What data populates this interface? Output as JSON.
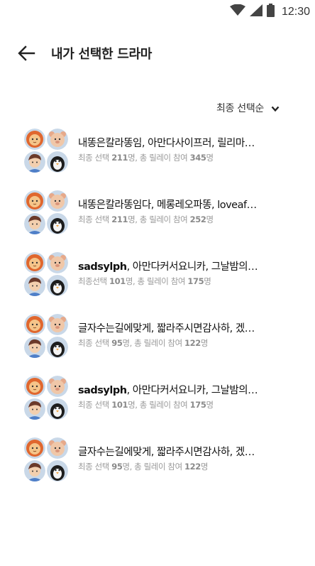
{
  "status_bar": {
    "time": "12:30"
  },
  "header": {
    "title": "내가 선택한 드라마"
  },
  "sort": {
    "label": "최종 선택순"
  },
  "meta_labels": {
    "selected": "최종 선택",
    "selected_compact": "최종선택",
    "people": "명",
    "total": ", 총 릴레이 참여"
  },
  "dramas": [
    {
      "title_bold": "",
      "title_rest": "내똥은칼라똥임, 아만다사이프러, 릴리마…",
      "selected": "211",
      "total": "345",
      "compact": false
    },
    {
      "title_bold": "",
      "title_rest": "내똥은칼라똥임다, 메롱레오파똥, loveaf…",
      "selected": "211",
      "total": "252",
      "compact": false
    },
    {
      "title_bold": "sadsylph",
      "title_rest": ", 아만다커서요니카, 그날밤의…",
      "selected": "101",
      "total": "175",
      "compact": true
    },
    {
      "title_bold": "",
      "title_rest": "글자수는길에맞게, 짧라주시면감사하, 겠…",
      "selected": "95",
      "total": "122",
      "compact": false
    },
    {
      "title_bold": "sadsylph",
      "title_rest": ", 아만다커서요니카, 그날밤의…",
      "selected": "101",
      "total": "175",
      "compact": false
    },
    {
      "title_bold": "",
      "title_rest": "글자수는길에맞게, 짧라주시면감사하, 겠…",
      "selected": "95",
      "total": "122",
      "compact": false
    }
  ]
}
